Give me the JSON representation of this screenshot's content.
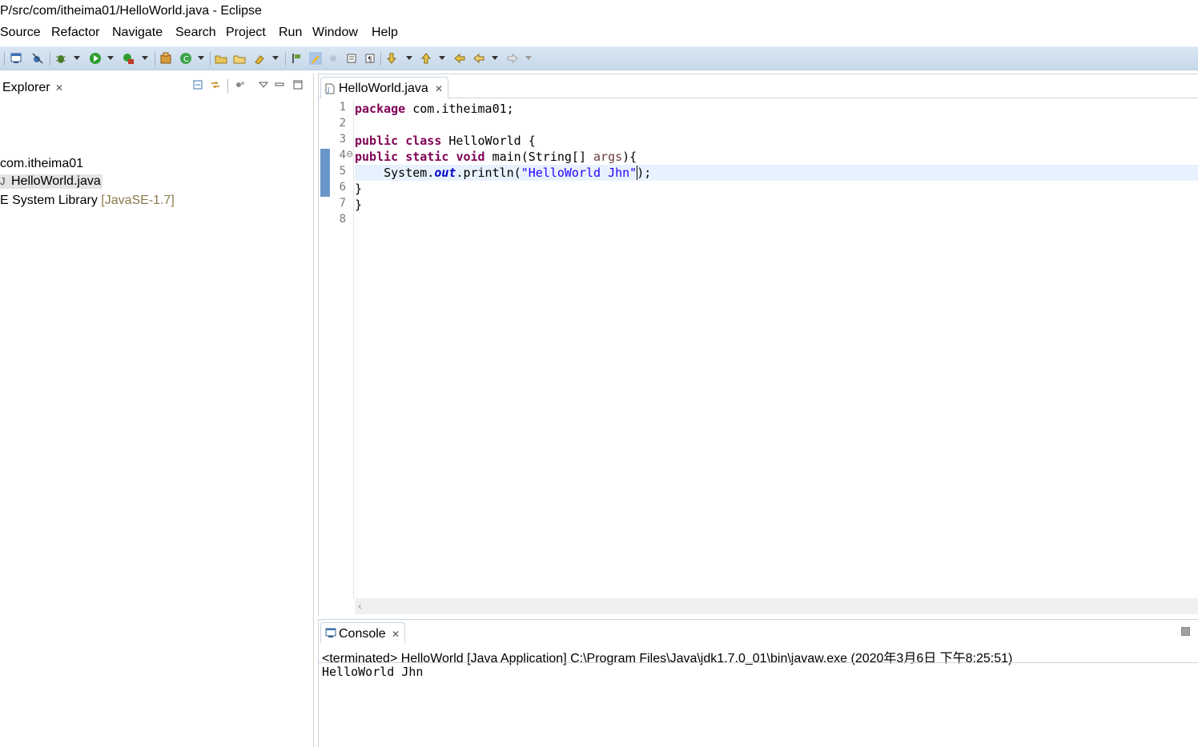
{
  "window": {
    "title": "P/src/com/itheima01/HelloWorld.java - Eclipse"
  },
  "menu": [
    "Source",
    "Refactor",
    "Navigate",
    "Search",
    "Project",
    "Run",
    "Window",
    "Help"
  ],
  "toolbar": {
    "icons": [
      "open-perspective-icon",
      "skip-breakpoints-icon",
      "debug-icon",
      "run-icon",
      "external-tools-icon",
      "new-java-project-icon",
      "new-java-class-icon",
      "open-type-icon",
      "open-folder-icon",
      "search-icon",
      "toggle-mark-occurrences-icon",
      "toggle-block-selection-icon",
      "show-whitespace-icon",
      "next-annotation-icon",
      "previous-annotation-icon",
      "last-edit-location-icon",
      "back-icon",
      "forward-icon"
    ]
  },
  "explorer": {
    "tab_label": "Explorer",
    "tree": {
      "package": "com.itheima01",
      "file": "HelloWorld.java",
      "library": "E System Library",
      "library_decoration": "[JavaSE-1.7]"
    }
  },
  "editor": {
    "tab_label": "HelloWorld.java",
    "line_numbers": [
      "1",
      "2",
      "3",
      "4",
      "5",
      "6",
      "7",
      "8"
    ],
    "fold_marker": "⊖",
    "code": {
      "l1": {
        "kw": "package",
        "rest": " com.itheima01;"
      },
      "l3": {
        "kw1": "public",
        "kw2": "class",
        "rest": " HelloWorld {"
      },
      "l4": {
        "kw1": "public",
        "kw2": "static",
        "kw3": "void",
        "mid": " main(String[] ",
        "param": "args",
        "end": "){"
      },
      "l5": {
        "pre": "    System.",
        "field": "out",
        "mid": ".println(",
        "str": "\"HelloWorld Jhn\"",
        "end": ");"
      },
      "l6": "}",
      "l7": "}"
    }
  },
  "console": {
    "tab_label": "Console",
    "status": "<terminated> HelloWorld [Java Application] C:\\Program Files\\Java\\jdk1.7.0_01\\bin\\javaw.exe (2020年3月6日 下午8:25:51)",
    "output": "HelloWorld Jhn"
  },
  "colors": {
    "keyword": "#7f0055",
    "string": "#2a00ff",
    "field": "#0000c0",
    "toolbar_bg": "#d3e1f0"
  }
}
